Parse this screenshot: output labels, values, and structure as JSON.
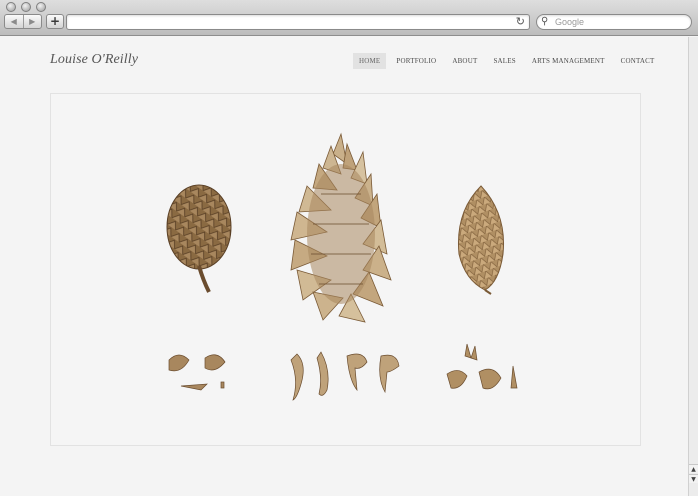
{
  "browser": {
    "back_glyph": "◀",
    "forward_glyph": "▶",
    "add_tab_glyph": "+",
    "reload_glyph": "↻",
    "search_icon": "search-icon",
    "search_placeholder": "Google"
  },
  "site": {
    "title": "Louise O'Reilly",
    "nav": [
      {
        "label": "HOME",
        "active": true
      },
      {
        "label": "PORTFOLIO",
        "active": false
      },
      {
        "label": "ABOUT",
        "active": false
      },
      {
        "label": "SALES",
        "active": false
      },
      {
        "label": "ARTS MANAGEMENT",
        "active": false
      },
      {
        "label": "CONTACT",
        "active": false
      }
    ]
  },
  "artwork": {
    "subject": "botanical-pinecone-illustration",
    "colors": {
      "dark": "#7a5a36",
      "mid": "#a8875e",
      "light": "#d6c2a0",
      "outline": "#5a4026"
    }
  },
  "scrollbar": {
    "up_glyph": "▲",
    "down_glyph": "▼"
  }
}
